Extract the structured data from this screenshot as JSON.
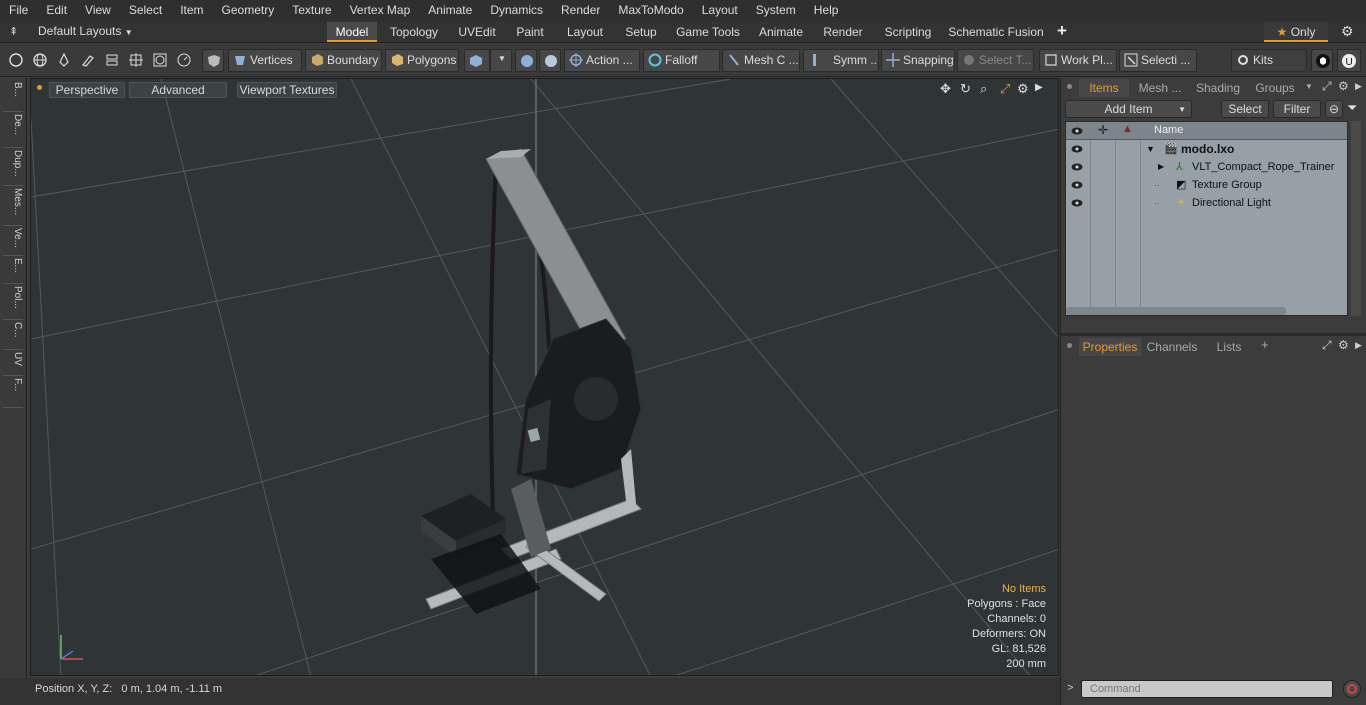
{
  "menu": [
    "File",
    "Edit",
    "View",
    "Select",
    "Item",
    "Geometry",
    "Texture",
    "Vertex Map",
    "Animate",
    "Dynamics",
    "Render",
    "MaxToModo",
    "Layout",
    "System",
    "Help"
  ],
  "layout_selector": "Default Layouts",
  "layout_tabs": [
    "Model",
    "Topology",
    "UVEdit",
    "Paint",
    "Layout",
    "Setup",
    "Game Tools",
    "Animate",
    "Render",
    "Scripting",
    "Schematic Fusion"
  ],
  "active_layout_tab": "Model",
  "add_tab_symbol": "+",
  "only_button": "Only",
  "toolbar": {
    "vertices": "Vertices",
    "boundary": "Boundary",
    "polygons": "Polygons",
    "action": "Action ...",
    "falloff": "Falloff",
    "mesh_c": "Mesh C ...",
    "symm": "Symm ...",
    "snapping": "Snapping",
    "select_t": "Select T...",
    "work_pl": "Work Pl...",
    "selecti": "Selecti ...",
    "kits": "Kits"
  },
  "left_tabs": [
    "B...",
    "De...",
    "Dup...",
    "Mes...",
    "Ve...",
    "E...",
    "Pol...",
    "C...",
    "UV",
    "F..."
  ],
  "viewport": {
    "perspective": "Perspective",
    "advanced": "Advanced",
    "viewport_textures": "Viewport Textures",
    "stats": [
      "No Items",
      "Polygons : Face",
      "Channels: 0",
      "Deformers: ON",
      "GL: 81,526",
      "200 mm"
    ]
  },
  "status": "Position X, Y, Z:   0 m, 1.04 m, -1.11 m",
  "right_panel": {
    "tabs": [
      "Items",
      "Mesh ...",
      "Shading",
      "Groups"
    ],
    "active_tab": "Items",
    "add_item": "Add Item",
    "select": "Select",
    "filter": "Filter",
    "name_header": "Name",
    "items": [
      "modo.lxo",
      "VLT_Compact_Rope_Trainer",
      "Texture Group",
      "Directional Light"
    ],
    "bottom_tabs": [
      "Properties",
      "Channels",
      "Lists"
    ],
    "active_bottom_tab": "Properties",
    "command_placeholder": "Command"
  },
  "colors": {
    "accent": "#e59a2b",
    "viewport_bg": "#2f3536",
    "items_bg": "#96a0a6"
  }
}
